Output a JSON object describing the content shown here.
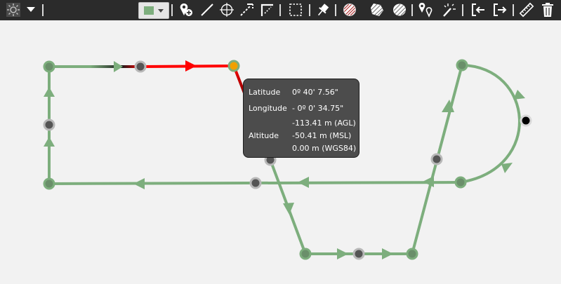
{
  "toolbar": {
    "items": [
      {
        "name": "brightness-icon",
        "role": "button"
      },
      {
        "name": "dropdown-arrow-icon",
        "role": "button"
      },
      {
        "name": "color-swatch-dropdown",
        "role": "button",
        "color": "#7dae7d"
      },
      {
        "name": "add-waypoint-icon",
        "role": "button"
      },
      {
        "name": "draw-line-icon",
        "role": "button"
      },
      {
        "name": "target-icon",
        "role": "button"
      },
      {
        "name": "edge-select-icon",
        "role": "button"
      },
      {
        "name": "corner-select-icon",
        "role": "button"
      },
      {
        "name": "box-select-icon",
        "role": "button"
      },
      {
        "name": "pin-icon",
        "role": "button"
      },
      {
        "name": "hatched-circle-icon",
        "role": "button"
      },
      {
        "name": "hatched-polygon-icon",
        "role": "button"
      },
      {
        "name": "hatched-oval-icon",
        "role": "button"
      },
      {
        "name": "multi-location-icon",
        "role": "button"
      },
      {
        "name": "magic-wand-icon",
        "role": "button"
      },
      {
        "name": "import-icon",
        "role": "button"
      },
      {
        "name": "export-icon",
        "role": "button"
      },
      {
        "name": "ruler-icon",
        "role": "button"
      },
      {
        "name": "trash-icon",
        "role": "button"
      }
    ]
  },
  "map": {
    "path_color": "#7dae7d",
    "highlight_color": "#ff0000",
    "selected_color": "#f0a000",
    "waypoint_color": "#6a8f6a"
  },
  "tooltip": {
    "latitude_label": "Latitude",
    "latitude_value": "0º 40' 7.56\"",
    "longitude_label": "Longitude",
    "longitude_value": "- 0º 0' 34.75\"",
    "altitude_label": "Altitude",
    "altitude_agl": "-113.41 m  (AGL)",
    "altitude_msl": "-50.41 m  (MSL)",
    "altitude_wgs84": "0.00 m  (WGS84)"
  }
}
